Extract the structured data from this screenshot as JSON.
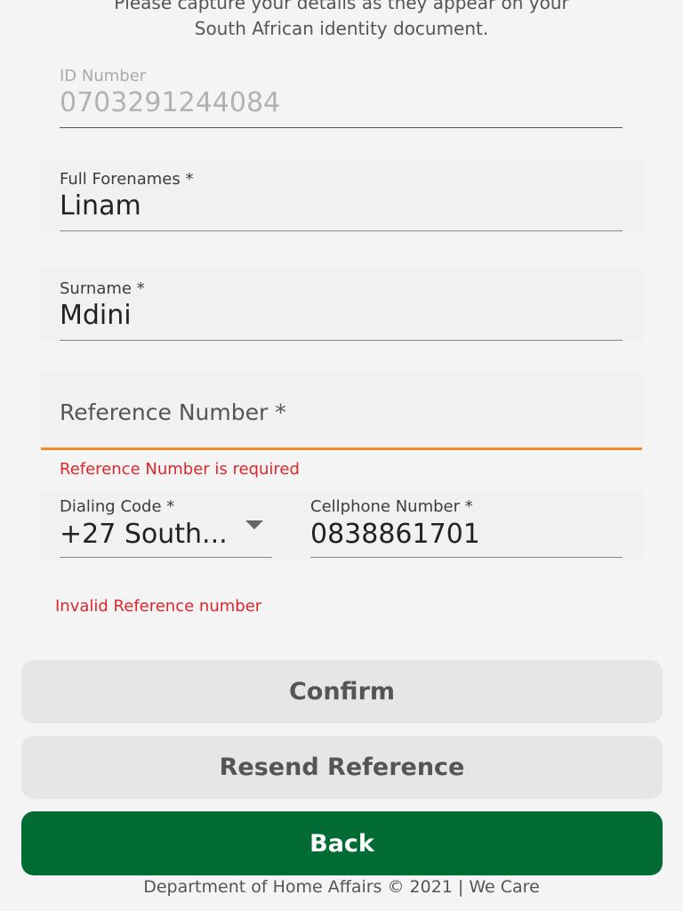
{
  "intro": {
    "line1": "Please capture your details as they appear on your",
    "line2": "South African identity document."
  },
  "form": {
    "id_number": {
      "label": "ID Number",
      "value": "0703291244084",
      "disabled": true
    },
    "forenames": {
      "label": "Full Forenames *",
      "value": "Linam"
    },
    "surname": {
      "label": "Surname *",
      "value": "Mdini"
    },
    "reference": {
      "placeholder": "Reference Number *",
      "value": "",
      "error": "Reference Number is required"
    },
    "dialing_code": {
      "label": "Dialing Code *",
      "value": "+27 South..."
    },
    "cellphone": {
      "label": "Cellphone Number *",
      "value": "0838861701"
    },
    "form_error": "Invalid Reference number"
  },
  "buttons": {
    "confirm": "Confirm",
    "resend": "Resend Reference",
    "back": "Back"
  },
  "footer": "Department of Home Affairs © 2021 | We Care",
  "colors": {
    "error": "#e0262b",
    "focus": "#f08a2a",
    "primary": "#006b33"
  }
}
